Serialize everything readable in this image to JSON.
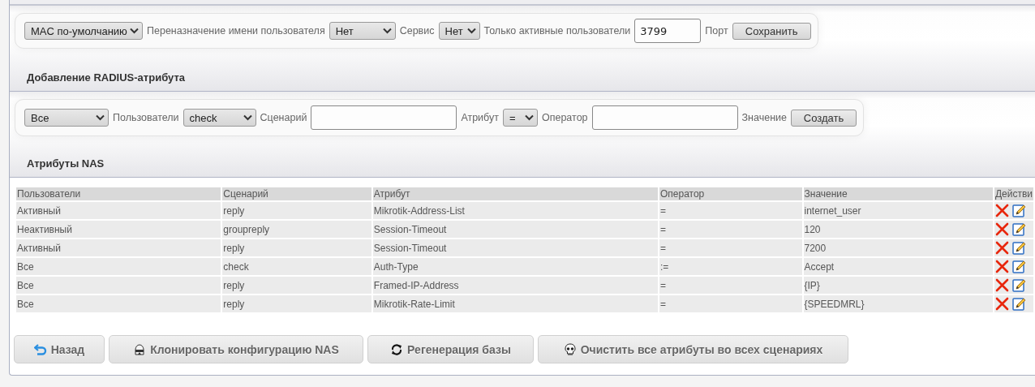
{
  "settings_toolbar": [
    {
      "kind": "select",
      "value": "MAC по-умолчанию"
    },
    {
      "kind": "label",
      "text": "Переназначение имени пользователя"
    },
    {
      "kind": "select",
      "value": "Нет"
    },
    {
      "kind": "label",
      "text": "Сервис"
    },
    {
      "kind": "select",
      "value": "Нет"
    },
    {
      "kind": "label",
      "text": "Только активные пользователи"
    },
    {
      "kind": "input",
      "value": "3799"
    },
    {
      "kind": "label",
      "text": "Порт"
    },
    {
      "kind": "button",
      "text": "Сохранить"
    }
  ],
  "add_section": {
    "title": "Добавление RADIUS-атрибута"
  },
  "add_toolbar": [
    {
      "kind": "select",
      "value": "Все"
    },
    {
      "kind": "label",
      "text": "Пользователи"
    },
    {
      "kind": "select",
      "value": "check"
    },
    {
      "kind": "label",
      "text": "Сценарий"
    },
    {
      "kind": "input"
    },
    {
      "kind": "label",
      "text": "Атрибут"
    },
    {
      "kind": "select",
      "value": "="
    },
    {
      "kind": "label",
      "text": "Оператор"
    },
    {
      "kind": "input"
    },
    {
      "kind": "label",
      "text": "Значение"
    },
    {
      "kind": "button",
      "text": "Создать"
    }
  ],
  "nas_section": {
    "title": "Атрибуты NAS"
  },
  "table": {
    "columns": [
      "Пользователи",
      "Сценарий",
      "Атрибут",
      "Оператор",
      "Значение",
      "Действи"
    ],
    "rows": [
      {
        "cells": [
          "Активный",
          "reply",
          "Mikrotik-Address-List",
          "=",
          "internet_user"
        ]
      },
      {
        "cells": [
          "Неактивный",
          "groupreply",
          "Session-Timeout",
          "=",
          "120"
        ]
      },
      {
        "cells": [
          "Активный",
          "reply",
          "Session-Timeout",
          "=",
          "7200"
        ]
      },
      {
        "cells": [
          "Все",
          "check",
          "Auth-Type",
          ":=",
          "Accept"
        ]
      },
      {
        "cells": [
          "Все",
          "reply",
          "Framed-IP-Address",
          "=",
          "{IP}"
        ]
      },
      {
        "cells": [
          "Все",
          "reply",
          "Mikrotik-Rate-Limit",
          "=",
          "{SPEEDMRL}"
        ]
      }
    ]
  },
  "buttons": [
    {
      "kind": "back",
      "label": "Назад"
    },
    {
      "kind": "clone",
      "label": "Клонировать конфигурацию NAS"
    },
    {
      "kind": "regenerate",
      "label": "Регенерация базы"
    },
    {
      "kind": "clear",
      "label": "Очистить все атрибуты во всех сценариях"
    }
  ]
}
